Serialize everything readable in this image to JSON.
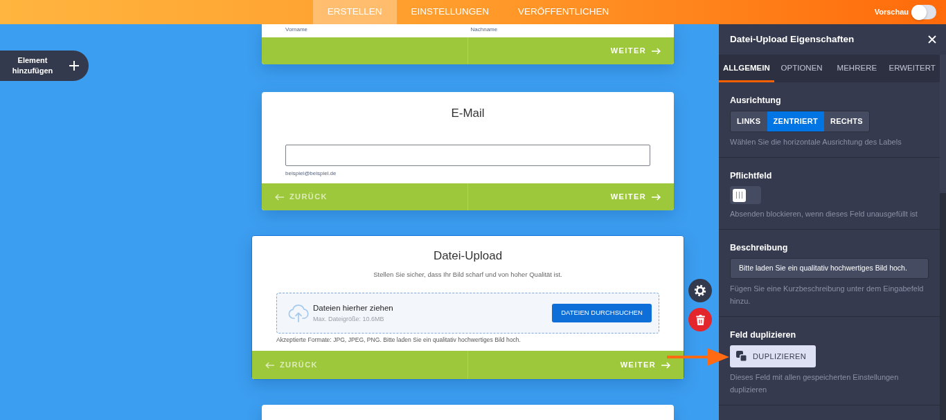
{
  "top_bar": {
    "tabs": [
      {
        "label": "ERSTELLEN",
        "selected": true
      },
      {
        "label": "EINSTELLUNGEN",
        "selected": false
      },
      {
        "label": "VERÖFFENTLICHEN",
        "selected": false
      }
    ],
    "preview": {
      "label": "Vorschau",
      "on": false
    }
  },
  "add_element": {
    "label": "Element hinzufügen"
  },
  "form_cards": [
    {
      "kind": "name",
      "selected": false,
      "sublabels": [
        "Vorname",
        "Nachname"
      ],
      "next": "WEITER"
    },
    {
      "kind": "email",
      "selected": false,
      "title": "E-Mail",
      "hint": "beispiel@beispiel.de",
      "back": "ZURÜCK",
      "next": "WEITER"
    },
    {
      "kind": "upload",
      "selected": true,
      "title": "Datei-Upload",
      "description": "Stellen Sie sicher, dass Ihr Bild scharf und von hoher Qualität ist.",
      "drop_title": "Dateien hierher ziehen",
      "max_size": "Max. Dateigröße: 10.6MB",
      "browse_button": "DATEIEN DURCHSUCHEN",
      "formats": "Akzeptierte Formate: JPG, JPEG, PNG. Bitte laden Sie ein qualitativ hochwertiges Bild hoch.",
      "back": "ZURÜCK",
      "next": "WEITER"
    },
    {
      "kind": "blank",
      "selected": false
    }
  ],
  "panel": {
    "title": "Datei-Upload Eigenschaften",
    "tabs": [
      {
        "label": "ALLGEMEIN",
        "selected": true
      },
      {
        "label": "OPTIONEN",
        "selected": false
      },
      {
        "label": "MEHRERE",
        "selected": false
      },
      {
        "label": "ERWEITERT",
        "selected": false
      }
    ],
    "sections": [
      {
        "kind": "segmented",
        "label": "Ausrichtung",
        "options": [
          {
            "label": "LINKS",
            "selected": false
          },
          {
            "label": "ZENTRIERT",
            "selected": true
          },
          {
            "label": "RECHTS",
            "selected": false
          }
        ],
        "hint": "Wählen Sie die horizontale Ausrichtung des Labels"
      },
      {
        "kind": "toggle",
        "label": "Pflichtfeld",
        "on": false,
        "hint": "Absenden blockieren, wenn dieses Feld unausgefüllt ist"
      },
      {
        "kind": "text",
        "label": "Beschreibung",
        "value": "Bitte laden Sie ein qualitativ hochwertiges Bild hoch.",
        "hint": "Fügen Sie eine Kurzbeschreibung unter dem Eingabefeld hinzu."
      },
      {
        "kind": "action",
        "label": "Feld duplizieren",
        "button": "DUPLIZIEREN",
        "hint": "Dieses Feld mit allen gespeicherten Einstellungen duplizieren"
      }
    ]
  }
}
